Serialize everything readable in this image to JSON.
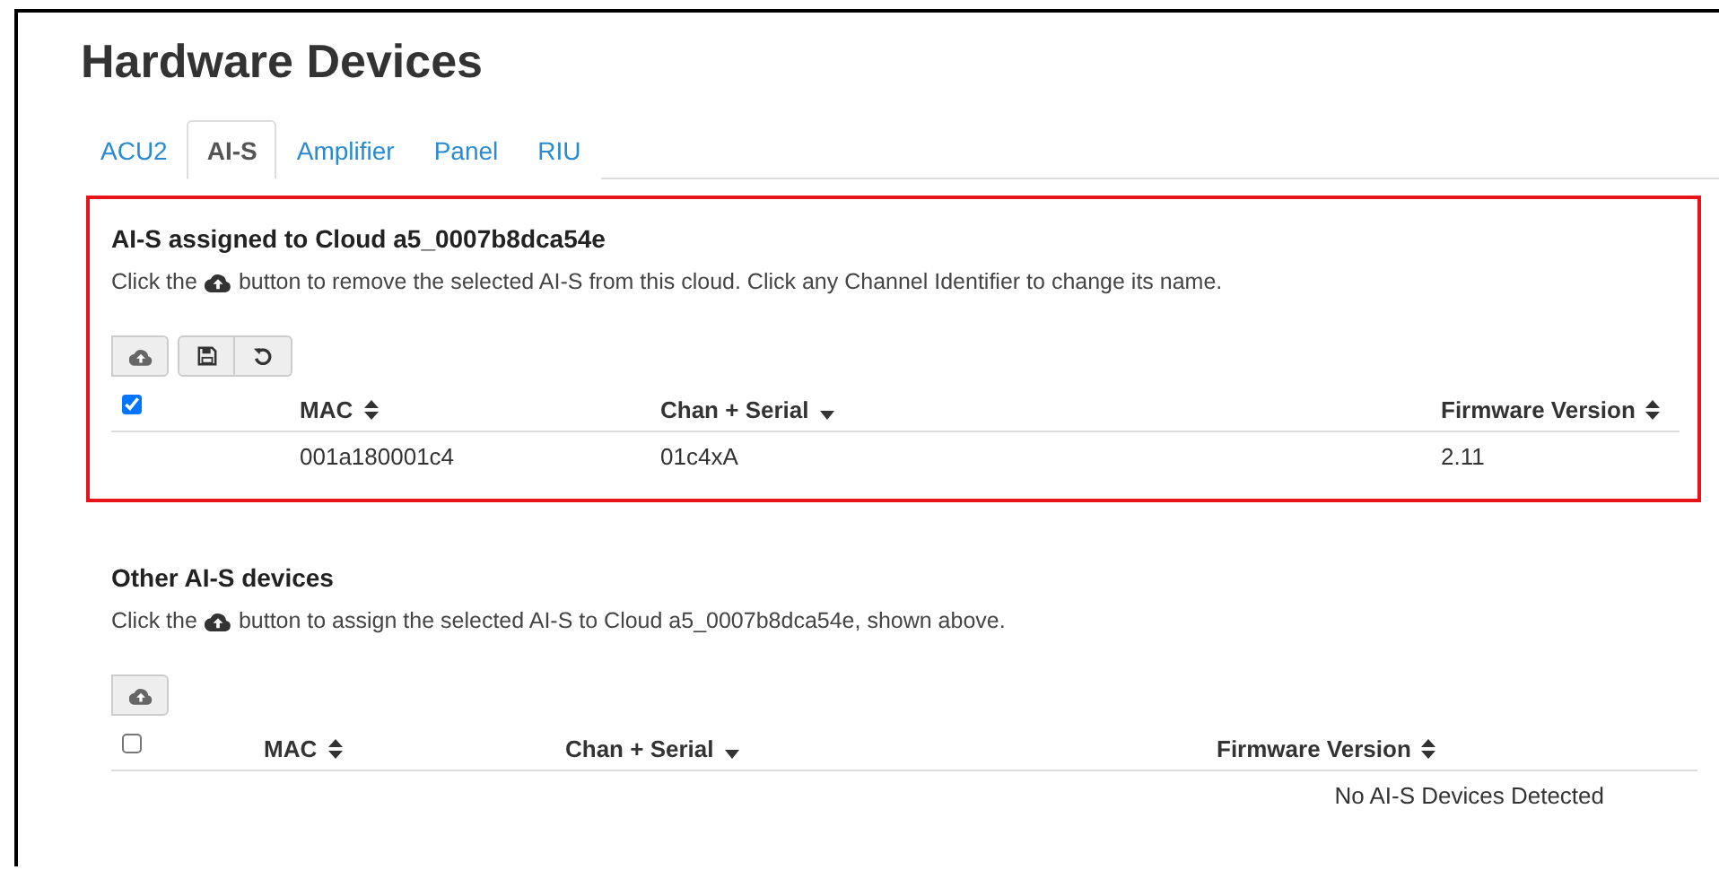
{
  "title": "Hardware Devices",
  "tabs": [
    {
      "label": "ACU2",
      "selected": false
    },
    {
      "label": "AI-S",
      "selected": true
    },
    {
      "label": "Amplifier",
      "selected": false
    },
    {
      "label": "Panel",
      "selected": false
    },
    {
      "label": "RIU",
      "selected": false
    }
  ],
  "sections": [
    {
      "heading": "AI-S assigned to Cloud a5_0007b8dca54e",
      "highlighted": true,
      "description": {
        "before": "Click the",
        "after": "button to remove the selected AI-S from this cloud. Click any Channel Identifier to change its name."
      },
      "toolbar": [
        [
          {
            "kind": "cloud"
          }
        ],
        [
          {
            "kind": "save"
          },
          {
            "kind": "undo"
          }
        ]
      ],
      "select_all": {
        "checked": true
      },
      "columns": [
        {
          "label": "MAC",
          "sorted": false
        },
        {
          "label": "Chan + Serial",
          "sorted": true
        },
        {
          "label": "Firmware Version",
          "sorted": false
        }
      ],
      "rows": [
        [
          "001a180001c4",
          "01c4xA",
          "2.11"
        ]
      ]
    },
    {
      "heading": "Other AI-S devices",
      "highlighted": false,
      "description": {
        "before": "Click the",
        "after": "button to assign the selected AI-S to Cloud a5_0007b8dca54e, shown above."
      },
      "toolbar": [
        [
          {
            "kind": "cloud"
          }
        ]
      ],
      "select_all": {
        "checked": false
      },
      "columns": [
        {
          "label": "MAC",
          "sorted": false
        },
        {
          "label": "Chan + Serial",
          "sorted": true
        },
        {
          "label": "Firmware Version",
          "sorted": false
        }
      ],
      "empty_message": "No AI-S Devices Detected"
    }
  ]
}
